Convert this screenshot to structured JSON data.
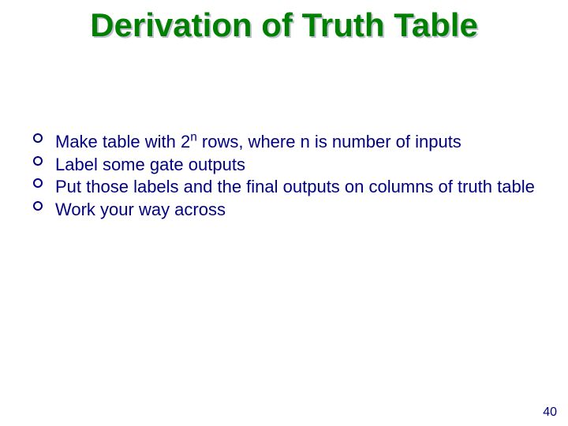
{
  "slide": {
    "title": "Derivation of Truth Table",
    "bullets": [
      {
        "html": "Make table with 2<sup>n</sup> rows, where n is number of inputs"
      },
      {
        "html": "Label some gate outputs"
      },
      {
        "html": "Put those labels and the final outputs on columns of truth table"
      },
      {
        "html": "Work your way across"
      }
    ],
    "page_number": "40"
  }
}
